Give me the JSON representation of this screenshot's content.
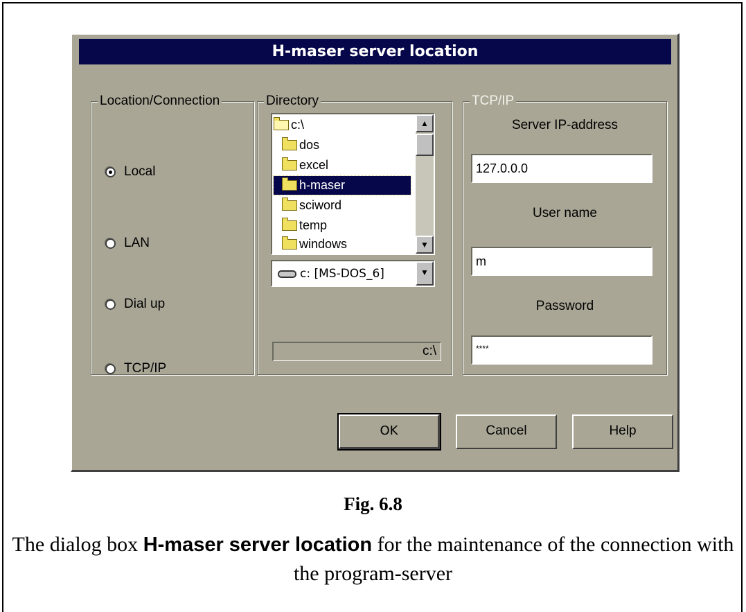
{
  "dialog": {
    "title": "H-maser server location",
    "location_group": {
      "label": "Location/Connection",
      "options": [
        {
          "label": "Local",
          "selected": true
        },
        {
          "label": "LAN",
          "selected": false
        },
        {
          "label": "Dial up",
          "selected": false
        },
        {
          "label": "TCP/IP",
          "selected": false
        }
      ]
    },
    "directory_group": {
      "label": "Directory",
      "folders": [
        {
          "name": "c:\\",
          "icon": "open-folder-icon",
          "selected": false
        },
        {
          "name": "dos",
          "icon": "folder-icon",
          "selected": false
        },
        {
          "name": "excel",
          "icon": "folder-icon",
          "selected": false
        },
        {
          "name": "h-maser",
          "icon": "folder-icon",
          "selected": true
        },
        {
          "name": "sciword",
          "icon": "folder-icon",
          "selected": false
        },
        {
          "name": "temp",
          "icon": "folder-icon",
          "selected": false
        },
        {
          "name": "windows",
          "icon": "folder-icon",
          "selected": false
        }
      ],
      "drive": "c: [MS-DOS_6]",
      "path": "c:\\"
    },
    "tcp_group": {
      "label": "TCP/IP",
      "ip_label": "Server IP-address",
      "ip_value": "127.0.0.0",
      "user_label": "User name",
      "user_value": "m",
      "password_label": "Password",
      "password_value": "****"
    },
    "buttons": {
      "ok": "OK",
      "cancel": "Cancel",
      "help": "Help"
    }
  },
  "figure": {
    "title": "Fig. 6.8",
    "caption_pre": "The dialog box ",
    "caption_bold": "H-maser server location",
    "caption_post": " for the maintenance of the connection with the program-server"
  },
  "colors": {
    "dialog_bg": "#a9a696",
    "titlebar": "#06064a",
    "selection": "#06064a"
  }
}
